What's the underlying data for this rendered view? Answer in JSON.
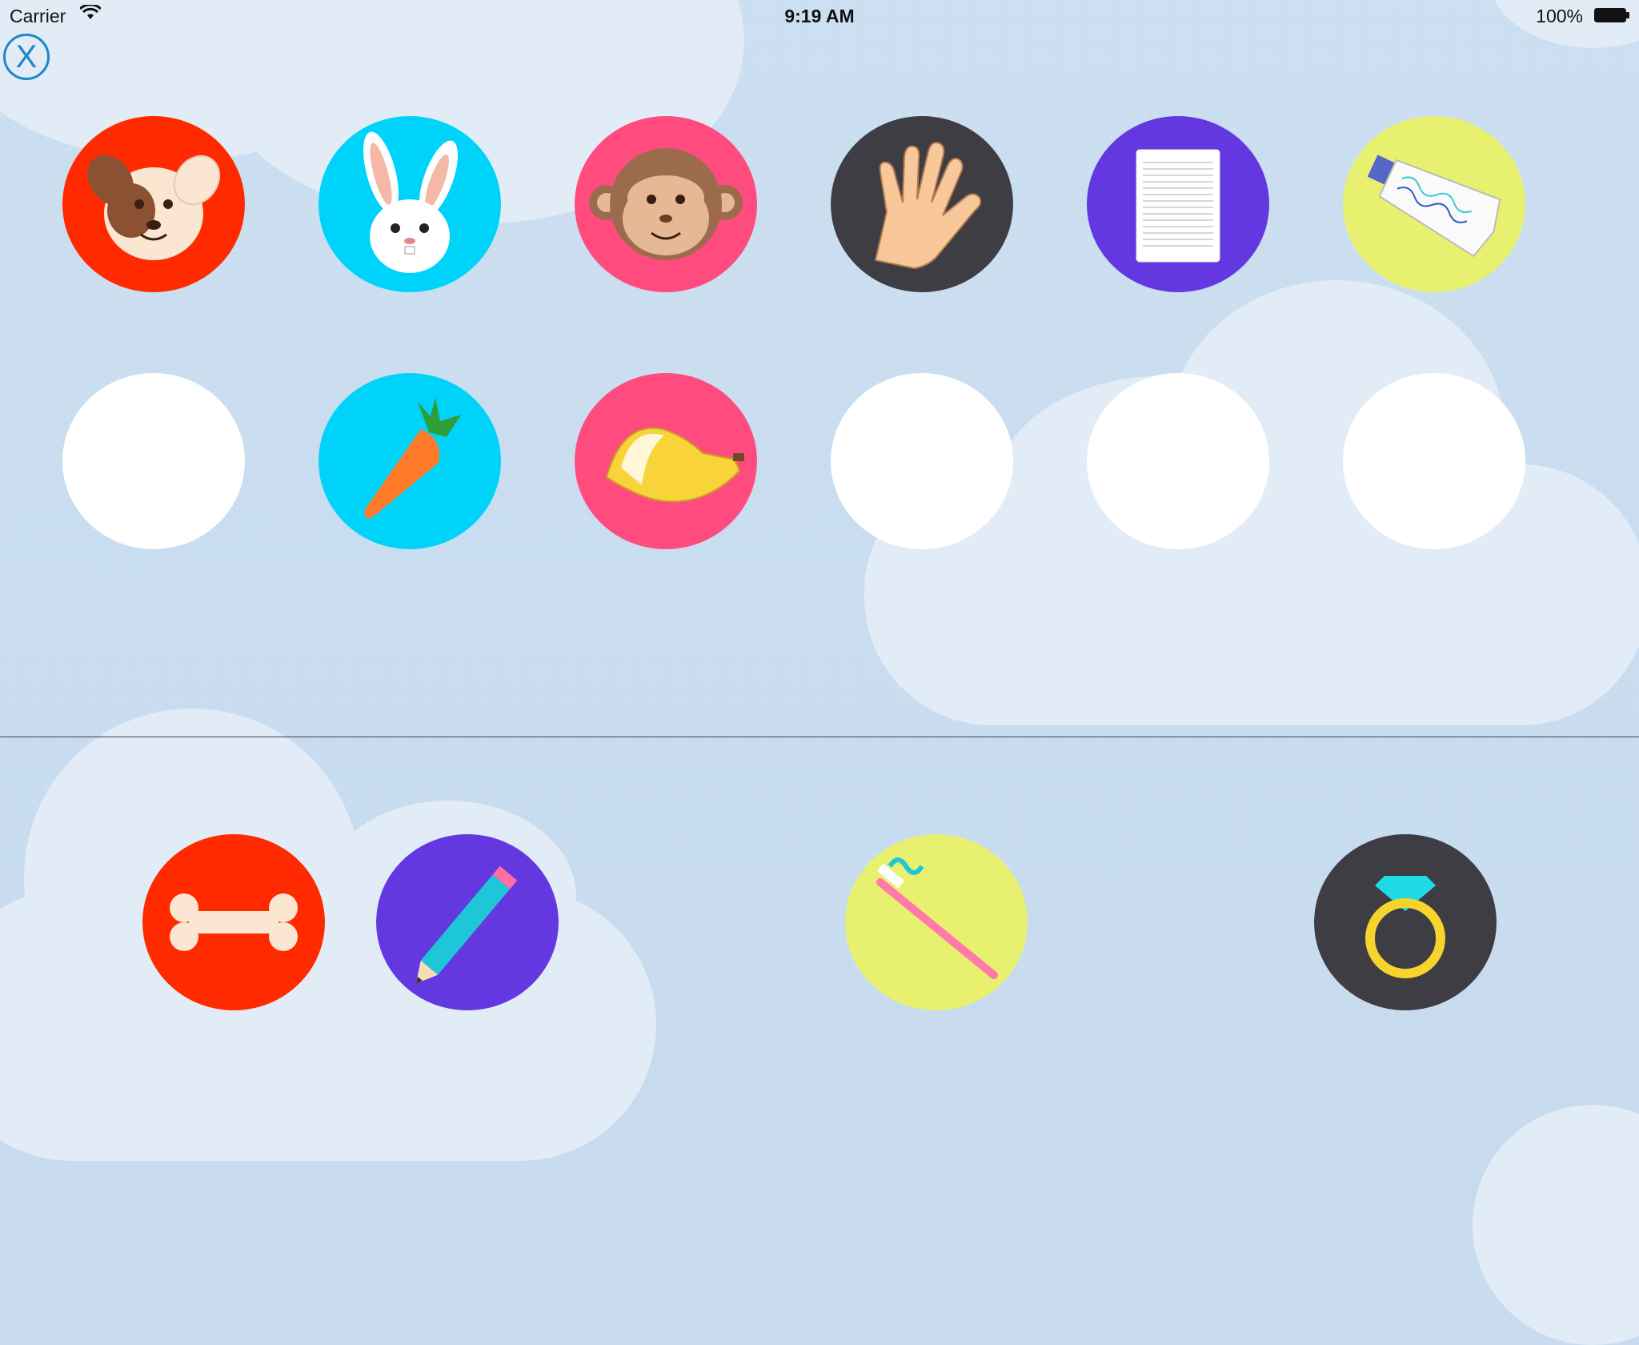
{
  "status_bar": {
    "carrier": "Carrier",
    "time": "9:19 AM",
    "battery": "100%"
  },
  "close_button": {
    "label": "X"
  },
  "colors": {
    "red": "#ff2a00",
    "cyan": "#00d3fa",
    "pink": "#ff4b7e",
    "charcoal": "#3e3d43",
    "purple": "#6438e0",
    "yellow": "#e8f070",
    "empty": "#ffffff"
  },
  "target_grid": [
    [
      "dog",
      "rabbit",
      "monkey",
      "hand",
      "paper",
      "toothpaste"
    ],
    [
      "empty",
      "carrot",
      "banana",
      "empty",
      "empty",
      "empty"
    ]
  ],
  "answer_tray": [
    "bone",
    "pencil",
    "toothbrush",
    "ring"
  ]
}
